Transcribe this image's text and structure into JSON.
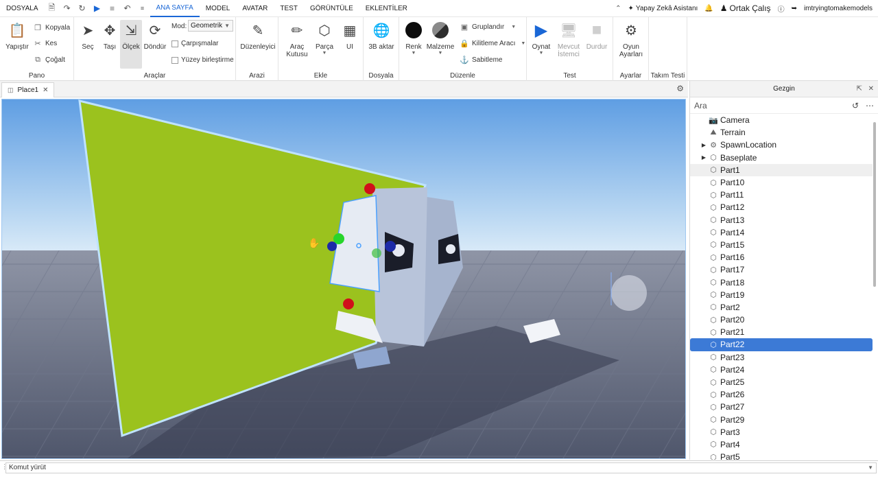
{
  "menu": {
    "file": "DOSYALA",
    "tabs": [
      "ANA SAYFA",
      "MODEL",
      "AVATAR",
      "TEST",
      "GÖRÜNTÜLE",
      "EKLENTİLER"
    ],
    "active_tab": "ANA SAYFA",
    "right": {
      "assistant": "Yapay Zekâ Asistanı",
      "collab": "Ortak Çalış",
      "username": "imtryingtomakemodels"
    }
  },
  "ribbon": {
    "pano": {
      "label": "Pano",
      "paste": "Yapıştır",
      "copy": "Kopyala",
      "cut": "Kes",
      "duplicate": "Çoğalt"
    },
    "araclar": {
      "label": "Araçlar",
      "select": "Seç",
      "move": "Taşı",
      "scale": "Ölçek",
      "rotate": "Döndür",
      "mode_label": "Mod:",
      "mode_value": "Geometrik",
      "collisions": "Çarpışmalar",
      "join_surfaces": "Yüzey birleştirme"
    },
    "arazi": {
      "label": "Arazi",
      "editor": "Düzenleyici"
    },
    "ekle": {
      "label": "Ekle",
      "toolbox": "Araç Kutusu",
      "toolbox_l1": "Araç",
      "toolbox_l2": "Kutusu",
      "part": "Parça",
      "ui": "UI"
    },
    "dosyala": {
      "label": "Dosyala",
      "import3d": "3B aktar"
    },
    "duzenle": {
      "label": "Düzenle",
      "color": "Renk",
      "material": "Malzeme",
      "group": "Gruplandır",
      "lock": "Kilitleme Aracı",
      "anchor": "Sabitleme"
    },
    "test": {
      "label": "Test",
      "play": "Oynat",
      "client_l1": "Mevcut",
      "client_l2": "İstemci",
      "stop": "Durdur"
    },
    "ayarlar": {
      "label": "Ayarlar",
      "game_l1": "Oyun",
      "game_l2": "Ayarları"
    },
    "takim": {
      "label": "Takım Testi"
    }
  },
  "doc_tab": {
    "name": "Place1"
  },
  "explorer": {
    "title": "Gezgin",
    "search_placeholder": "Ara",
    "items": [
      {
        "name": "Camera",
        "icon": "camera-icon",
        "expandable": false
      },
      {
        "name": "Terrain",
        "icon": "terrain-icon",
        "expandable": false
      },
      {
        "name": "SpawnLocation",
        "icon": "gear-icon",
        "expandable": true
      },
      {
        "name": "Baseplate",
        "icon": "part-icon",
        "expandable": true
      },
      {
        "name": "Part1",
        "icon": "part-icon",
        "state": "hover"
      },
      {
        "name": "Part10",
        "icon": "part-icon"
      },
      {
        "name": "Part11",
        "icon": "part-icon"
      },
      {
        "name": "Part12",
        "icon": "part-icon"
      },
      {
        "name": "Part13",
        "icon": "part-icon"
      },
      {
        "name": "Part14",
        "icon": "part-icon"
      },
      {
        "name": "Part15",
        "icon": "part-icon"
      },
      {
        "name": "Part16",
        "icon": "part-icon"
      },
      {
        "name": "Part17",
        "icon": "part-icon"
      },
      {
        "name": "Part18",
        "icon": "part-icon"
      },
      {
        "name": "Part19",
        "icon": "part-icon"
      },
      {
        "name": "Part2",
        "icon": "part-icon"
      },
      {
        "name": "Part20",
        "icon": "part-icon"
      },
      {
        "name": "Part21",
        "icon": "part-icon"
      },
      {
        "name": "Part22",
        "icon": "part-icon",
        "state": "selected"
      },
      {
        "name": "Part23",
        "icon": "part-icon"
      },
      {
        "name": "Part24",
        "icon": "part-icon"
      },
      {
        "name": "Part25",
        "icon": "part-icon"
      },
      {
        "name": "Part26",
        "icon": "part-icon"
      },
      {
        "name": "Part27",
        "icon": "part-icon"
      },
      {
        "name": "Part29",
        "icon": "part-icon"
      },
      {
        "name": "Part3",
        "icon": "part-icon"
      },
      {
        "name": "Part4",
        "icon": "part-icon"
      },
      {
        "name": "Part5",
        "icon": "part-icon"
      }
    ]
  },
  "command_bar": {
    "placeholder": "Komut yürüt"
  },
  "colors": {
    "accent": "#1a67d6",
    "selection": "#3c7ad6",
    "green_plane": "#9bc21e",
    "sky_top": "#5f9ee3",
    "sky_horizon": "#d9eaf8",
    "ground": "#5e6478"
  }
}
